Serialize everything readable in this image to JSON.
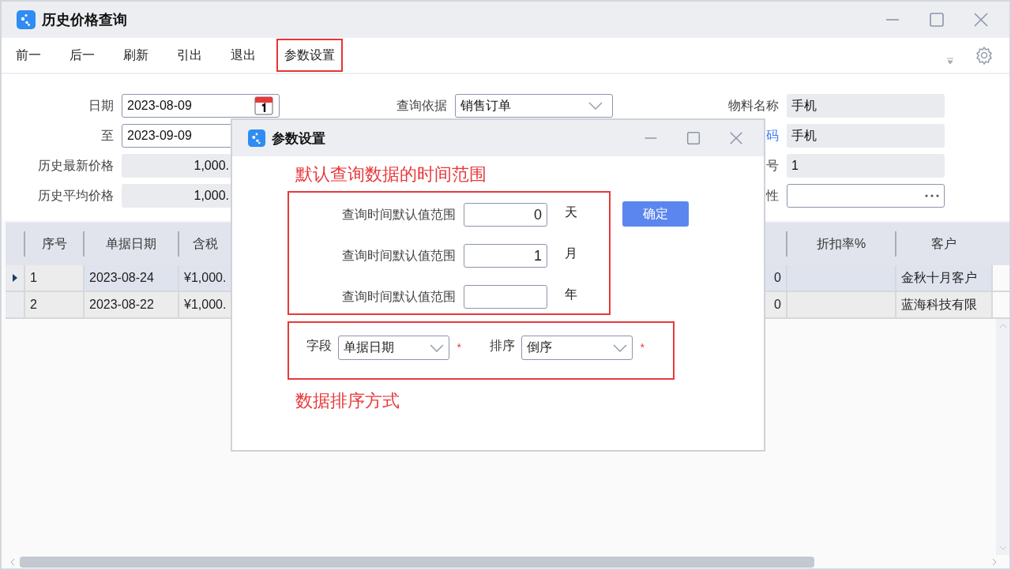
{
  "window": {
    "title": "历史价格查询"
  },
  "toolbar": [
    {
      "label": "前一",
      "highlighted": false
    },
    {
      "label": "后一",
      "highlighted": false
    },
    {
      "label": "刷新",
      "highlighted": false
    },
    {
      "label": "引出",
      "highlighted": false
    },
    {
      "label": "退出",
      "highlighted": false
    },
    {
      "label": "参数设置",
      "highlighted": true
    }
  ],
  "form": {
    "left_fields": [
      {
        "label": "日期",
        "value": "2023-08-09",
        "kind": "date"
      },
      {
        "label": "至",
        "value": "2023-09-09",
        "kind": "input"
      },
      {
        "label": "历史最新价格",
        "value": "1,000.",
        "kind": "readonly"
      },
      {
        "label": "历史平均价格",
        "value": "1,000.",
        "kind": "readonly"
      }
    ],
    "middle_fields": [
      {
        "label": "查询依据",
        "value": "销售订单",
        "kind": "select"
      }
    ],
    "right_fields": [
      {
        "label": "物料名称",
        "value": "手机",
        "kind": "readonly",
        "link": false
      },
      {
        "label": "码",
        "value": "手机",
        "kind": "readonly",
        "link": true
      },
      {
        "label": "号",
        "value": "1",
        "kind": "readonly",
        "link": false
      },
      {
        "label": "性",
        "kind": "lookup",
        "link": false
      }
    ]
  },
  "table": {
    "columns": {
      "seq": "序号",
      "date": "单据日期",
      "price": "含税",
      "discount": "折扣率%",
      "customer": "客户"
    },
    "rows": [
      {
        "selected": true,
        "seq": "1",
        "date": "2023-08-24",
        "price": "¥1,000.",
        "column_4": "0",
        "customer": "金秋十月客户"
      },
      {
        "selected": false,
        "seq": "2",
        "date": "2023-08-22",
        "price": "¥1,000.",
        "column_4": "0",
        "customer": "蓝海科技有限"
      }
    ]
  },
  "dialog": {
    "title": "参数设置",
    "annotation_top": "默认查询数据的时间范围",
    "range_rows": [
      {
        "label": "查询时间默认值范围",
        "value": "0",
        "unit": "天"
      },
      {
        "label": "查询时间默认值范围",
        "value": "1",
        "unit": "月"
      },
      {
        "label": "查询时间默认值范围",
        "unit": "年"
      }
    ],
    "confirm": "确定",
    "sort_fields": [
      {
        "label": "字段",
        "value": "单据日期",
        "mark": "*"
      },
      {
        "label": "排序",
        "value": "倒序",
        "mark": "*"
      }
    ],
    "annotation_bottom": "数据排序方式"
  }
}
